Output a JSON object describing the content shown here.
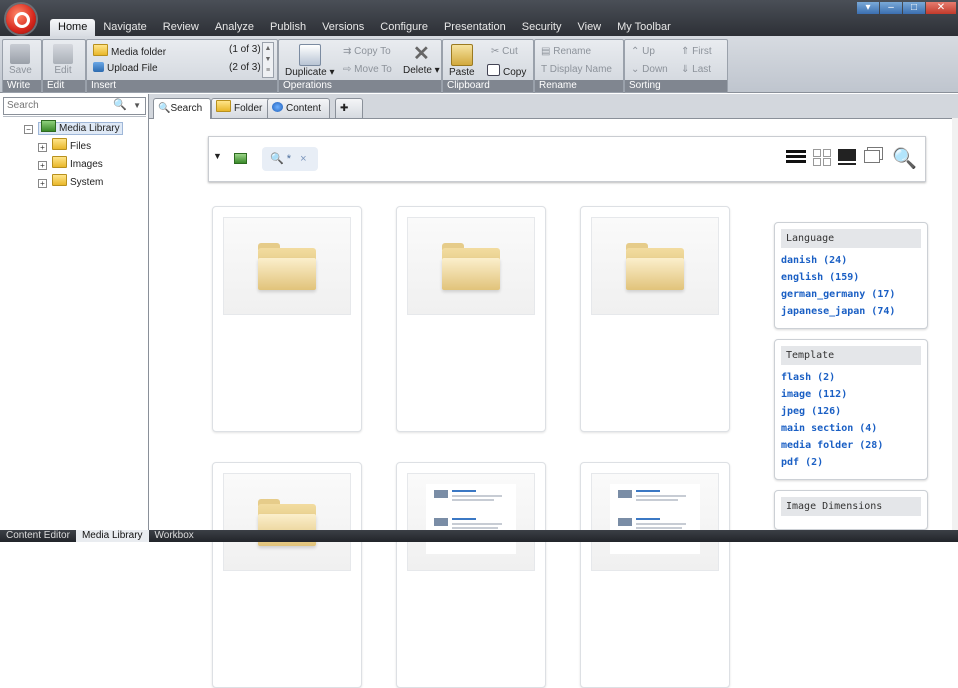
{
  "ribbon": {
    "tabs": [
      "Home",
      "Navigate",
      "Review",
      "Analyze",
      "Publish",
      "Versions",
      "Configure",
      "Presentation",
      "Security",
      "View",
      "My Toolbar"
    ],
    "active_tab": "Home",
    "write": {
      "save": "Save",
      "label": "Write"
    },
    "edit": {
      "edit": "Edit",
      "label": "Edit"
    },
    "insert": {
      "items": [
        {
          "label": "Media folder",
          "count": "(1 of 3)"
        },
        {
          "label": "Upload File",
          "count": "(2 of 3)"
        }
      ],
      "label": "Insert"
    },
    "operations": {
      "duplicate": "Duplicate",
      "copy_to": "Copy To",
      "move_to": "Move To",
      "delete": "Delete",
      "label": "Operations"
    },
    "clipboard": {
      "paste": "Paste",
      "cut": "Cut",
      "copy": "Copy",
      "label": "Clipboard"
    },
    "rename": {
      "rename": "Rename",
      "display_name": "Display Name",
      "label": "Rename"
    },
    "sorting": {
      "up": "Up",
      "first": "First",
      "down": "Down",
      "last": "Last",
      "label": "Sorting"
    }
  },
  "tree": {
    "search_placeholder": "Search",
    "nodes": [
      {
        "label": "Media Library",
        "level": 0,
        "selected": true
      },
      {
        "label": "Files",
        "level": 1
      },
      {
        "label": "Images",
        "level": 1
      },
      {
        "label": "System",
        "level": 1
      }
    ]
  },
  "main_tabs": [
    "Search",
    "Folder",
    "Content",
    ""
  ],
  "search": {
    "token": "*",
    "clear": "×"
  },
  "facets": [
    {
      "title": "Language",
      "items": [
        "danish (24)",
        "english (159)",
        "german_germany (17)",
        "japanese_japan (74)"
      ]
    },
    {
      "title": "Template",
      "items": [
        "flash (2)",
        "image (112)",
        "jpeg (126)",
        "main section (4)",
        "media folder (28)",
        "pdf (2)"
      ]
    },
    {
      "title": "Image Dimensions",
      "items": []
    }
  ],
  "bottom_tabs": [
    "Content Editor",
    "Media Library",
    "Workbox"
  ],
  "active_bottom_tab": "Media Library"
}
